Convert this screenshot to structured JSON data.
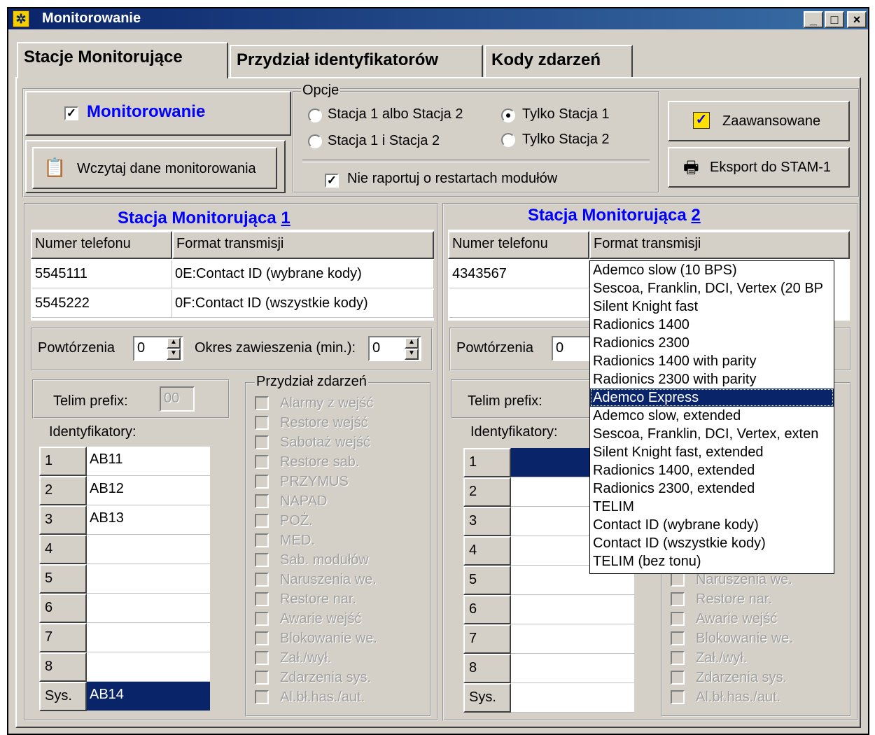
{
  "window": {
    "title": "Monitorowanie",
    "min_label": "_",
    "max_label": "□",
    "close_label": "×"
  },
  "tabs": [
    {
      "label": "Stacje Monitorujące",
      "active": true
    },
    {
      "label": "Przydział identyfikatorów",
      "active": false
    },
    {
      "label": "Kody zdarzeń",
      "active": false
    }
  ],
  "monitoring": {
    "label": "Monitorowanie",
    "checked": true
  },
  "load_button": "Wczytaj dane monitorowania",
  "options": {
    "group_label": "Opcje",
    "radios": [
      {
        "label": "Stacja 1 albo Stacja 2",
        "selected": false
      },
      {
        "label": "Tylko Stacja 1",
        "selected": true
      },
      {
        "label": "Stacja 1 i Stacja 2",
        "selected": false
      },
      {
        "label": "Tylko Stacja 2",
        "selected": false
      }
    ],
    "no_restart_label": "Nie raportuj o restartach modułów",
    "no_restart_checked": true
  },
  "advanced_button": "Zaawansowane",
  "export_button": "Eksport do STAM-1",
  "station1": {
    "title_prefix": "Stacja Monitorująca ",
    "title_num": "1",
    "col_phone": "Numer telefonu",
    "col_format": "Format transmisji",
    "rows": [
      {
        "phone": "5545111",
        "format": "0E:Contact ID (wybrane kody)"
      },
      {
        "phone": "5545222",
        "format": "0F:Contact ID (wszystkie kody)"
      }
    ],
    "repeats_label": "Powtórzenia",
    "repeats_value": "0",
    "suspend_label": "Okres zawieszenia (min.):",
    "suspend_value": "0",
    "telim_label": "Telim prefix:",
    "telim_value": "00",
    "ids_label": "Identyfikatory:",
    "ids": [
      {
        "num": "1",
        "value": "AB11"
      },
      {
        "num": "2",
        "value": "AB12"
      },
      {
        "num": "3",
        "value": "AB13"
      },
      {
        "num": "4",
        "value": ""
      },
      {
        "num": "5",
        "value": ""
      },
      {
        "num": "6",
        "value": ""
      },
      {
        "num": "7",
        "value": ""
      },
      {
        "num": "8",
        "value": ""
      },
      {
        "num": "Sys.",
        "value": "AB14"
      }
    ],
    "events_label": "Przydział zdarzeń",
    "events": [
      "Alarmy z wejść",
      "Restore wejść",
      "Sabotaż wejść",
      "Restore sab.",
      "PRZYMUS",
      "NAPAD",
      "POŻ.",
      "MED.",
      "Sab. modułów",
      "Naruszenia we.",
      "Restore nar.",
      "Awarie wejść",
      "Blokowanie we.",
      "Zał./wył.",
      "Zdarzenia sys.",
      "Al.bł.has./aut."
    ]
  },
  "station2": {
    "title_prefix": "Stacja Monitorująca ",
    "title_num": "2",
    "col_phone": "Numer telefonu",
    "col_format": "Format transmisji",
    "rows": [
      {
        "phone": "4343567",
        "format": ""
      }
    ],
    "repeats_label": "Powtórzenia",
    "repeats_value": "0",
    "telim_label": "Telim prefix:",
    "ids_label": "Identyfikatory:",
    "ids": [
      {
        "num": "1",
        "value": ""
      },
      {
        "num": "2",
        "value": ""
      },
      {
        "num": "3",
        "value": ""
      },
      {
        "num": "4",
        "value": ""
      },
      {
        "num": "5",
        "value": ""
      },
      {
        "num": "6",
        "value": ""
      },
      {
        "num": "7",
        "value": ""
      },
      {
        "num": "8",
        "value": ""
      },
      {
        "num": "Sys.",
        "value": ""
      }
    ],
    "events_visible": [
      "Naruszenia we.",
      "Restore nar.",
      "Awarie wejść",
      "Blokowanie we.",
      "Zał./wył.",
      "Zdarzenia sys.",
      "Al.bł.has./aut."
    ]
  },
  "format_dropdown": {
    "selected": "Ademco Express",
    "items": [
      "Ademco slow (10 BPS)",
      "Sescoa, Franklin, DCI, Vertex (20 BP",
      "Silent Knight fast",
      "Radionics 1400",
      "Radionics 2300",
      "Radionics 1400 with parity",
      "Radionics 2300 with parity",
      "Ademco Express",
      "Ademco slow, extended",
      "Sescoa, Franklin, DCI, Vertex, exten",
      "Silent Knight fast, extended",
      "Radionics 1400, extended",
      "Radionics 2300, extended",
      "TELIM",
      "Contact ID (wybrane kody)",
      "Contact ID (wszystkie kody)",
      "TELIM (bez tonu)"
    ]
  },
  "colors": {
    "title_bar": "#0a246a",
    "accent_text": "#0000ff",
    "face": "#d4d0c8",
    "selection": "#0a246a"
  }
}
